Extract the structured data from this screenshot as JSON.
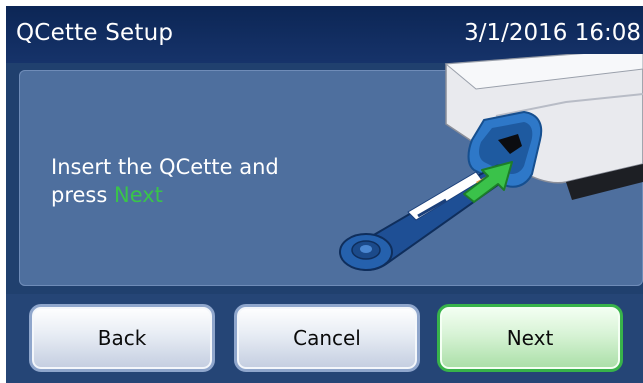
{
  "header": {
    "title": "QCette Setup",
    "datetime": "3/1/2016 16:08"
  },
  "instruction": {
    "text_before": "Insert the QCette and press ",
    "highlight": "Next",
    "highlight_color": "#39c44a"
  },
  "buttons": {
    "back_label": "Back",
    "cancel_label": "Cancel",
    "next_label": "Next"
  },
  "colors": {
    "titlebar": "#0c2655",
    "panel": "#4e6f9e",
    "next_border": "#38b34a",
    "button_border": "#8fa6cc"
  },
  "illustration": {
    "description_icon": "qcette-insert-illustration"
  }
}
